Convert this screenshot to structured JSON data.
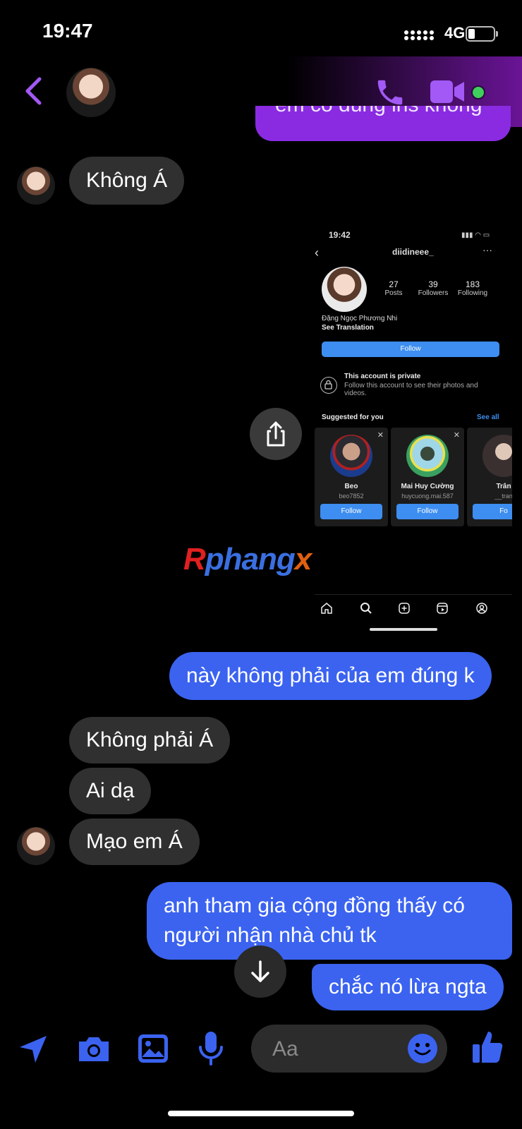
{
  "status_bar": {
    "time": "19:47",
    "network": "4G",
    "battery_level": 0.25
  },
  "header": {
    "accent_color": "#a259f5",
    "online": true
  },
  "messages": {
    "top_partial": "em có đúng ins không",
    "m1": "Không Á",
    "m2": "này không phải của em đúng k",
    "m3": "Không phải Á",
    "m4": "Ai dạ",
    "m5": "Mạo em Á",
    "m6_line1": "anh tham gia cộng đồng thấy có",
    "m6_line2": "người nhận nhà chủ tk",
    "m7": "chắc nó lừa ngta"
  },
  "screenshot": {
    "time": "19:42",
    "username": "diidineee_",
    "posts_count": "27",
    "posts_label": "Posts",
    "followers_count": "39",
    "followers_label": "Followers",
    "following_count": "183",
    "following_label": "Following",
    "full_name": "Đặng Ngọc Phương Nhi",
    "see_translation": "See Translation",
    "follow_label": "Follow",
    "private_title": "This account is private",
    "private_sub": "Follow this account to see their photos and videos.",
    "suggested_title": "Suggested for you",
    "see_all": "See all",
    "suggestions": [
      {
        "name": "Beo",
        "handle": "beo7852",
        "button": "Follow"
      },
      {
        "name": "Mai Huy Cường",
        "handle": "huycuong.mai.587",
        "button": "Follow"
      },
      {
        "name": "Trân",
        "handle": "__tran",
        "button": "Fo"
      }
    ]
  },
  "watermark": {
    "part1": "R",
    "part2": "phang",
    "part3": "x"
  },
  "composer": {
    "placeholder": "Aa"
  },
  "colors": {
    "outgoing": "#3b63f0",
    "incoming": "#303030",
    "icon_blue": "#3b63f0"
  }
}
